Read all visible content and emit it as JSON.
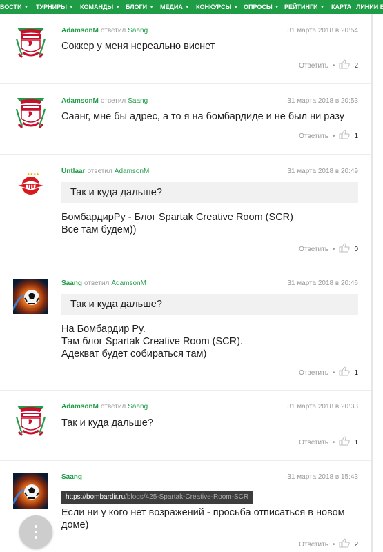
{
  "nav": {
    "items": [
      {
        "label": "ВОСТИ",
        "caret": "▼"
      },
      {
        "label": "ТУРНИРЫ",
        "caret": "▼"
      },
      {
        "label": "КОМАНДЫ",
        "caret": "▼"
      },
      {
        "label": "БЛОГИ",
        "caret": "▼"
      },
      {
        "label": "МЕДИА",
        "caret": "▼"
      },
      {
        "label": "КОНКУРСЫ",
        "caret": "▼"
      },
      {
        "label": "ОПРОСЫ",
        "caret": "▼"
      },
      {
        "label": "РЕЙТИНГИ",
        "caret": "▼"
      },
      {
        "label": "КАРТА",
        "caret": ""
      },
      {
        "label": "ЛИНИИ БК",
        "caret": ""
      }
    ]
  },
  "common": {
    "replied": "ответил",
    "reply_action": "Ответить",
    "separator": "•"
  },
  "comments": [
    {
      "author": "AdamsonM",
      "target": "Saang",
      "date": "31 марта 2018 в 20:54",
      "avatar": "liverpool-crest",
      "lines": [
        "Соккер у меня нереально виснет"
      ],
      "likes": "2"
    },
    {
      "author": "AdamsonM",
      "target": "Saang",
      "date": "31 марта 2018 в 20:53",
      "avatar": "liverpool-crest",
      "lines": [
        "Сaанг, мне бы адрес, а то я на бомбардиде и не был ни разу"
      ],
      "likes": "1"
    },
    {
      "author": "Untlaar",
      "target": "AdamsonM",
      "date": "31 марта 2018 в 20:49",
      "avatar": "spartak-logo",
      "quote": "Так и куда дальше?",
      "lines": [
        "БомбардирРу - Блог Spartak Creative Room (SCR)",
        "Все там будем))"
      ],
      "likes": "0"
    },
    {
      "author": "Saang",
      "target": "AdamsonM",
      "date": "31 марта 2018 в 20:46",
      "avatar": "fire-ball",
      "quote": "Так и куда дальше?",
      "lines": [
        "На Бомбардир Ру.",
        "Там блог Spartak Creative Room (SCR).",
        "Адекват будет собираться там)"
      ],
      "likes": "1"
    },
    {
      "author": "AdamsonM",
      "target": "Saang",
      "date": "31 марта 2018 в 20:33",
      "avatar": "liverpool-crest",
      "lines": [
        "Так и куда дальше?"
      ],
      "likes": "1"
    },
    {
      "author": "Saang",
      "target": "",
      "date": "31 марта 2018 в 15:43",
      "avatar": "fire-ball",
      "link": {
        "host": "https://bombardir.ru",
        "path": "/blogs/425-Spartak-Creative-Room-SCR"
      },
      "lines": [
        "Если ни у кого нет возражений - просьба отписаться в новом",
        "доме)"
      ],
      "likes": "2"
    }
  ]
}
